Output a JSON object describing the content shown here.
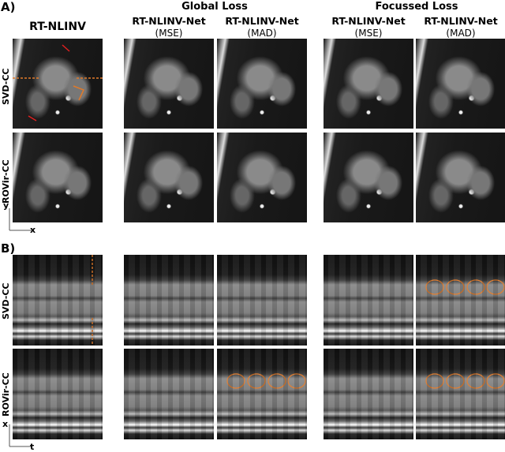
{
  "panels": {
    "a": "A)",
    "b": "B)"
  },
  "groups": {
    "global": "Global Loss",
    "focussed": "Focussed Loss"
  },
  "columns": [
    {
      "title": "RT-NLINV",
      "sub": ""
    },
    {
      "title": "RT-NLINV-Net",
      "sub": "(MSE)"
    },
    {
      "title": "RT-NLINV-Net",
      "sub": "(MAD)"
    },
    {
      "title": "RT-NLINV-Net",
      "sub": "(MSE)"
    },
    {
      "title": "RT-NLINV-Net",
      "sub": "(MAD)"
    }
  ],
  "rows": [
    "SVD-CC",
    "ROVir-CC"
  ],
  "axes": {
    "a_y": "y",
    "a_x": "x",
    "b_y": "x",
    "b_x": "t"
  },
  "colors": {
    "annotation_orange": "#e07a2a",
    "arrow_red": "#e02020"
  }
}
